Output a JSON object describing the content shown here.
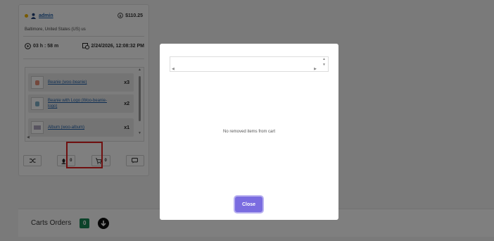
{
  "card": {
    "username": "admin",
    "amount": "$110.25",
    "location": "Baltimore, United States (US) us",
    "duration": "03 h : 58 m",
    "timestamp": "2/24/2026, 12:08:32 PM"
  },
  "items": [
    {
      "name": "Beanie (woo-beanie)",
      "qty": "x3"
    },
    {
      "name": "Beanie with Logo (Woo-beanie-logo)",
      "qty": "x2"
    },
    {
      "name": "Album (woo-album)",
      "qty": "x1"
    }
  ],
  "actions": {
    "bot_count": "0",
    "cart_count": "0"
  },
  "orders": {
    "title": "Carts Orders",
    "count": "0"
  },
  "modal": {
    "empty_message": "No removed items from cart",
    "close_label": "Close"
  },
  "colors": {
    "accent": "#7a6ce0",
    "success": "#198754",
    "highlight": "#e02020",
    "status_dot": "#f0b400"
  }
}
